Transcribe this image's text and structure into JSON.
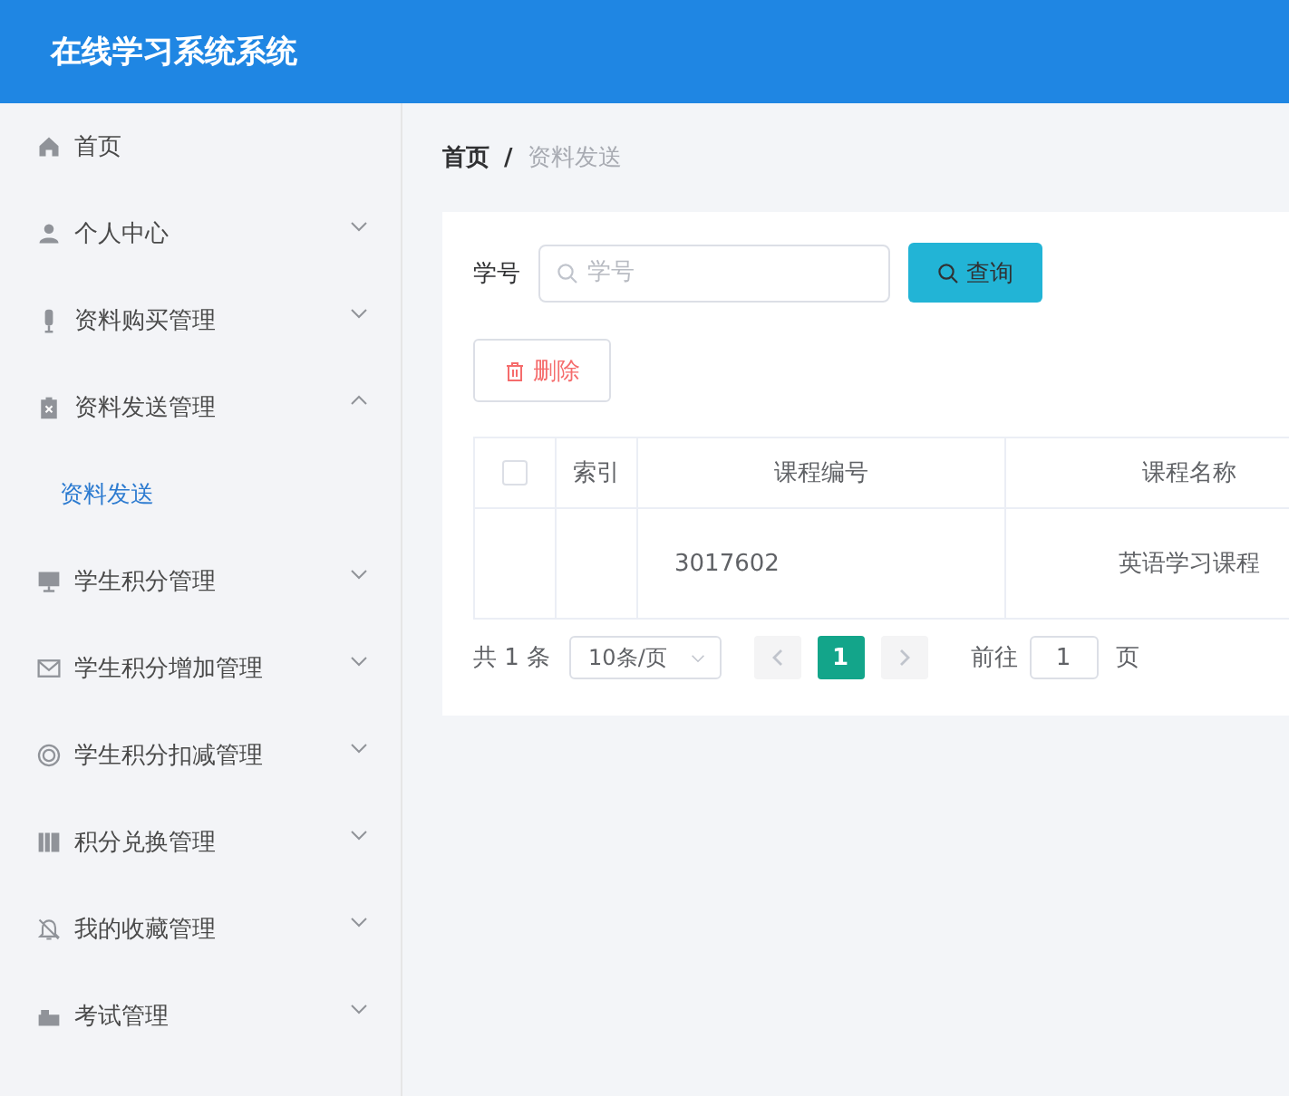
{
  "header": {
    "title": "在线学习系统系统"
  },
  "sidebar": {
    "items": [
      {
        "label": "首页",
        "selected": false
      },
      {
        "label": "个人中心",
        "expanded": false,
        "selected": false
      },
      {
        "label": "资料购买管理",
        "expanded": false,
        "selected": false
      },
      {
        "label": "资料发送管理",
        "expanded": true,
        "selected": false,
        "children": [
          {
            "label": "资料发送",
            "selected": true
          }
        ]
      },
      {
        "label": "学生积分管理",
        "expanded": false,
        "selected": false
      },
      {
        "label": "学生积分增加管理",
        "expanded": false,
        "selected": false
      },
      {
        "label": "学生积分扣减管理",
        "expanded": false,
        "selected": false
      },
      {
        "label": "积分兑换管理",
        "expanded": false,
        "selected": false
      },
      {
        "label": "我的收藏管理",
        "expanded": false,
        "selected": false
      },
      {
        "label": "考试管理",
        "expanded": false,
        "selected": false
      }
    ]
  },
  "breadcrumb": {
    "separator": "/",
    "items": [
      {
        "label": "首页"
      },
      {
        "label": "资料发送"
      }
    ]
  },
  "search": {
    "label": "学号",
    "placeholder": "学号",
    "button": "查询"
  },
  "delete_button": "删除",
  "table": {
    "select_all_checked": false,
    "columns": [
      "索引",
      "课程编号",
      "课程名称"
    ],
    "rows": [
      {
        "course_no": "3017602",
        "course_name": "英语学习课程"
      }
    ]
  },
  "pagination": {
    "total": "共 1 条",
    "page_size": "10条/页",
    "pages": [
      {
        "label": "1",
        "selected": true
      }
    ],
    "goto_label": "前往",
    "goto_value": "1",
    "goto_suffix": "页"
  }
}
